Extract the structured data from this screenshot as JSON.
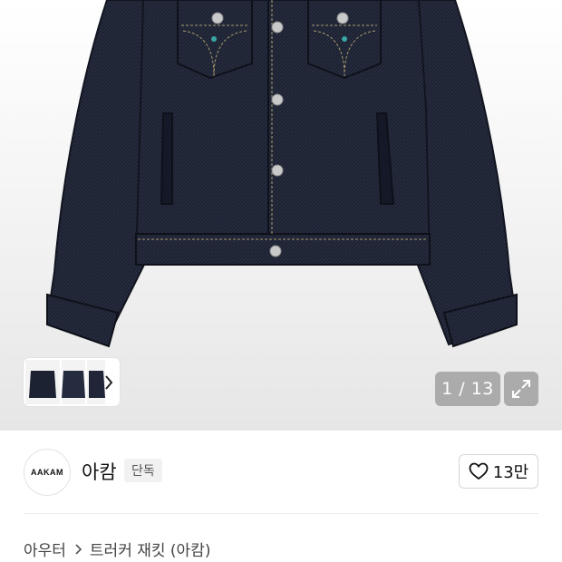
{
  "gallery": {
    "counter": "1 / 13",
    "expand_icon": "expand-icon",
    "next_icon": "chevron-right-icon",
    "product_color": "#1c2130"
  },
  "brand": {
    "logo_text": "AAKAM",
    "name": "아캄",
    "badge": "단독",
    "like_count": "13만",
    "like_icon": "heart-outline-icon"
  },
  "breadcrumb": {
    "category": "아우터",
    "separator_icon": "chevron-right-icon",
    "product": "트러커 재킷 (아캄)"
  }
}
